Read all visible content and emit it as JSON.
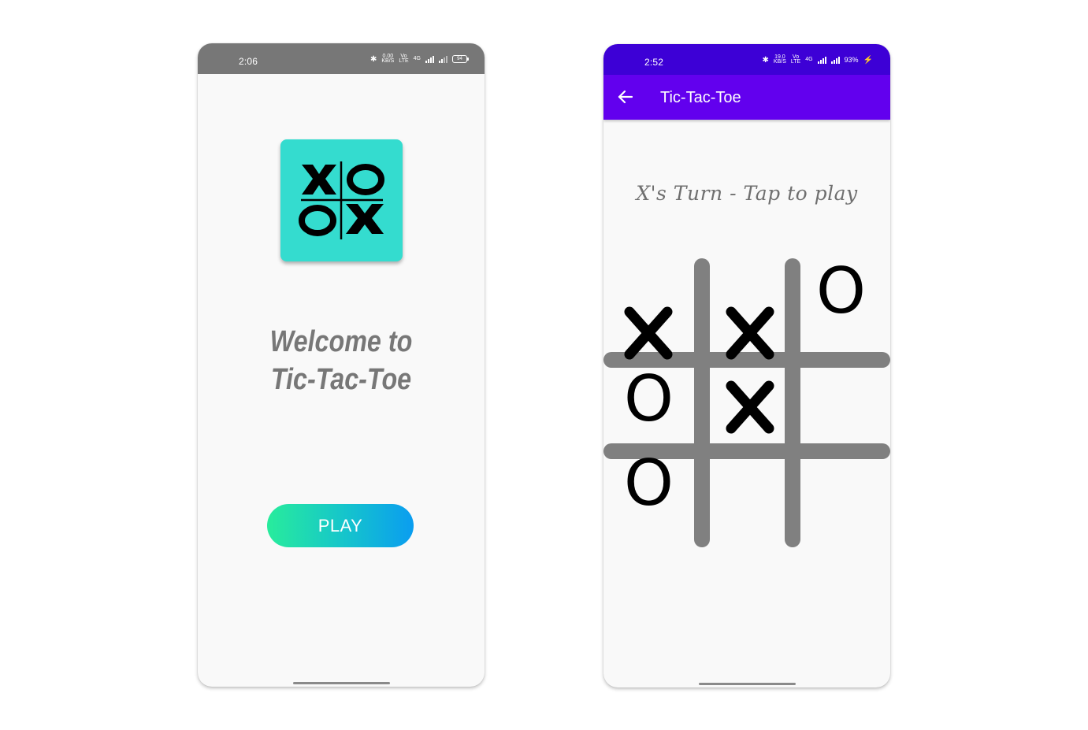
{
  "left_screen": {
    "status_bar": {
      "time": "2:06",
      "bluetooth_icon": "bluetooth-icon",
      "net_speed_value": "0.00",
      "net_speed_unit": "KB/S",
      "volte_top": "Vo",
      "volte_bottom": "LTE",
      "network": "4G",
      "battery": "94"
    },
    "logo": {
      "icon": "xo-logo-icon",
      "color": "#34dccf"
    },
    "welcome_line1": "Welcome to",
    "welcome_line2": "Tic-Tac-Toe",
    "play_button": "PLAY"
  },
  "right_screen": {
    "status_bar": {
      "time": "2:52",
      "bluetooth_icon": "bluetooth-icon",
      "net_speed_value": "19.0",
      "net_speed_unit": "KB/S",
      "volte_top": "Vo",
      "volte_bottom": "LTE",
      "network": "4G",
      "battery": "93%"
    },
    "toolbar": {
      "back_icon": "arrow-left-icon",
      "title": "Tic-Tac-Toe",
      "color": "#6200ee"
    },
    "turn_text": "X's Turn - Tap to play",
    "board": {
      "cells": [
        "X",
        "X",
        "O",
        "O",
        "X",
        "",
        "O",
        "",
        ""
      ]
    }
  }
}
